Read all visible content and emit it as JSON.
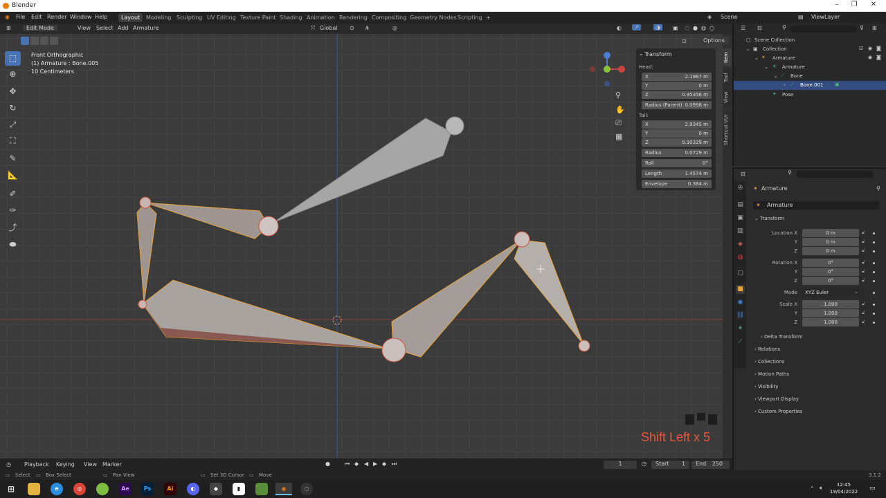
{
  "window": {
    "title": "Blender",
    "controls": [
      "–",
      "❐",
      "✕"
    ]
  },
  "menu": [
    "File",
    "Edit",
    "Render",
    "Window",
    "Help"
  ],
  "workspaces": [
    "Layout",
    "Modeling",
    "Sculpting",
    "UV Editing",
    "Texture Paint",
    "Shading",
    "Animation",
    "Rendering",
    "Compositing",
    "Geometry Nodes",
    "Scripting",
    "+"
  ],
  "active_workspace": "Layout",
  "scene": {
    "name": "Scene",
    "view_layer": "ViewLayer"
  },
  "viewport_header": {
    "mode": "Edit Mode",
    "menus": [
      "View",
      "Select",
      "Add",
      "Armature"
    ],
    "orientation": "Global",
    "options": "Options"
  },
  "viewport_info": {
    "line1": "Front Orthographic",
    "line2": "(1) Armature : Bone.005",
    "line3": "10 Centimeters"
  },
  "transform_panel": {
    "title": "Transform",
    "head_label": "Head:",
    "head": [
      {
        "k": "X",
        "v": "2.1967 m"
      },
      {
        "k": "Y",
        "v": "0 m"
      },
      {
        "k": "Z",
        "v": "0.95356 m"
      }
    ],
    "radius_parent": {
      "k": "Radius (Parent)",
      "v": "0.0998 m"
    },
    "tail_label": "Tail:",
    "tail": [
      {
        "k": "X",
        "v": "2.9345 m"
      },
      {
        "k": "Y",
        "v": "0 m"
      },
      {
        "k": "Z",
        "v": "0.30329 m"
      }
    ],
    "extra": [
      {
        "k": "Radius",
        "v": "0.0729 m"
      },
      {
        "k": "Roll",
        "v": "0°"
      },
      {
        "k": "Length",
        "v": "1.4574 m"
      },
      {
        "k": "Envelope",
        "v": "0.364 m"
      }
    ]
  },
  "n_tabs": [
    "Item",
    "Tool",
    "View",
    "Shortcut VUr"
  ],
  "outliner": {
    "rows": [
      "Scene Collection",
      "Collection",
      "Armature",
      "Armature",
      "Bone",
      "Bone.001",
      "Pose"
    ]
  },
  "properties": {
    "object": "Armature",
    "datablock": "Armature",
    "section": "Transform",
    "location_label": "Location X",
    "rotation_label": "Rotation X",
    "scale_label": "Scale X",
    "axis_y": "Y",
    "axis_z": "Z",
    "location": [
      "0 m",
      "0 m",
      "0 m"
    ],
    "rotation": [
      "0°",
      "0°",
      "0°"
    ],
    "mode_label": "Mode",
    "mode": "XYZ Euler",
    "scale": [
      "1.000",
      "1.000",
      "1.000"
    ],
    "delta": "Delta Transform",
    "sections": [
      "Relations",
      "Collections",
      "Motion Paths",
      "Visibility",
      "Viewport Display",
      "Custom Properties"
    ]
  },
  "timeline": {
    "menus": [
      "Playback",
      "Keying",
      "View",
      "Marker"
    ],
    "current_frame": "1",
    "start_label": "Start",
    "start": "1",
    "end_label": "End",
    "end": "250"
  },
  "statusbar": {
    "items": [
      "Select",
      "Box Select",
      "Pan View",
      "Set 3D Cursor",
      "Move"
    ],
    "version": "3.1.2"
  },
  "keystroke_overlay": "Shift Left x 5",
  "taskbar": {
    "time": "12:45",
    "date": "19/04/2022"
  },
  "colors": {
    "accent": "#4772b3",
    "selected_bone": "#e8a33a",
    "overlay_text": "#e8553a"
  }
}
